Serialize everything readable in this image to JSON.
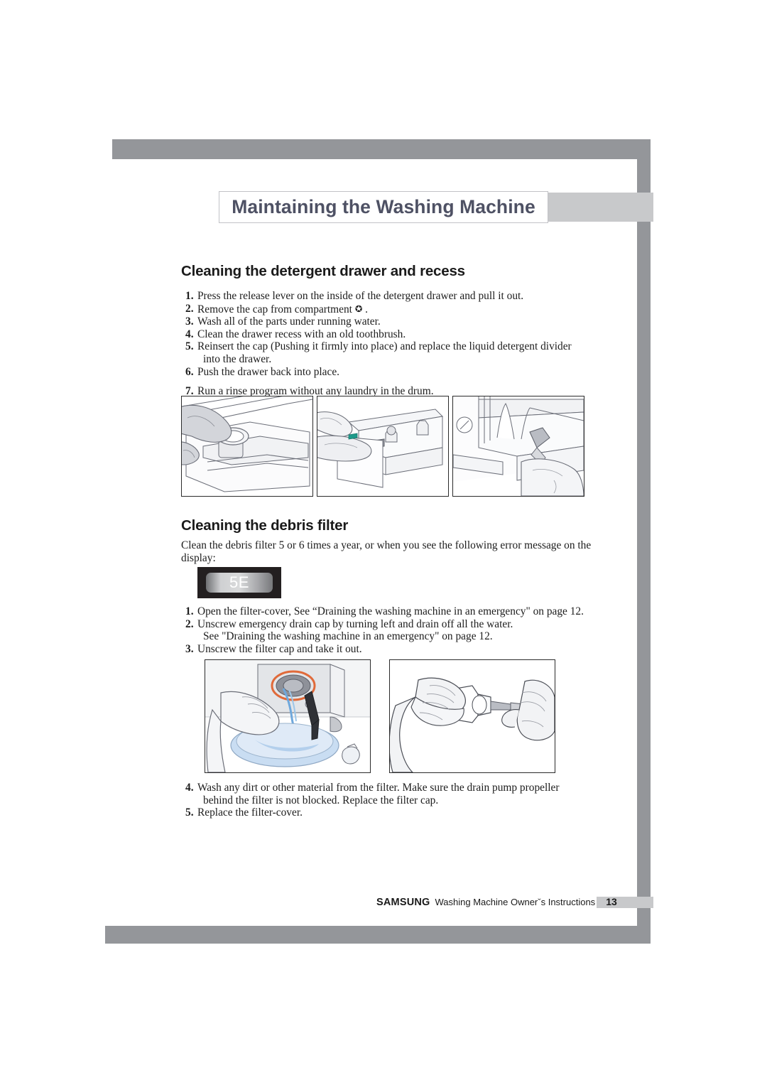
{
  "page": {
    "title": "Maintaining the Washing Machine",
    "number": "13"
  },
  "sections": [
    {
      "heading": "Cleaning the detergent drawer and recess",
      "steps": [
        {
          "num": "1.",
          "text": "Press the release lever on the inside of the detergent drawer and pull it out."
        },
        {
          "num": "2.",
          "text": "Remove the cap from compartment",
          "symbol": "✪",
          "suffix": "."
        },
        {
          "num": "3.",
          "text": "Wash all of the parts under running water."
        },
        {
          "num": "4.",
          "text": "Clean the drawer recess with an old toothbrush."
        },
        {
          "num": "5.",
          "text": "Reinsert the cap (Pushing it firmly into place) and replace the liquid detergent divider",
          "continuation": "into the drawer."
        },
        {
          "num": "6.",
          "text": "Push the drawer back into place."
        },
        {
          "num": "7.",
          "text": "Run a rinse program without any laundry in the drum."
        }
      ],
      "figures": [
        {
          "caption_name": "press-release-lever-figure"
        },
        {
          "caption_name": "remove-drawer-figure"
        },
        {
          "caption_name": "toothbrush-recess-figure"
        }
      ]
    },
    {
      "heading": "Cleaning the debris filter",
      "intro": "Clean the debris filter 5 or 6 times a year, or when you see the following error message on the display:",
      "error_display": {
        "code": "5E"
      },
      "steps": [
        {
          "num": "1.",
          "text": "Open the filter-cover, See “Draining the washing machine in an emergency\" on page 12."
        },
        {
          "num": "2.",
          "text": "Unscrew emergency drain cap by turning left and drain off all the water.",
          "continuation": "See \"Draining the washing machine in an emergency\" on page 12."
        },
        {
          "num": "3.",
          "text": "Unscrew the filter cap and take it out."
        }
      ],
      "figures": [
        {
          "caption_name": "drain-water-bowl-figure"
        },
        {
          "caption_name": "unscrew-filter-cap-figure"
        }
      ],
      "steps_after": [
        {
          "num": "4.",
          "text": "Wash any dirt or other material from the filter.  Make sure the drain pump propeller",
          "continuation": "behind the filter is not blocked. Replace the filter cap."
        },
        {
          "num": "5.",
          "text": "Replace the filter-cover."
        }
      ]
    }
  ],
  "footer": {
    "brand": "SAMSUNG",
    "document": "Washing Machine Ownerˇs Instructions",
    "page": "13"
  },
  "colors": {
    "bar_gray": "#94969a",
    "tab_light_gray": "#c8c9cb",
    "title_text": "#4e5164",
    "display_bg": "#231f20"
  }
}
